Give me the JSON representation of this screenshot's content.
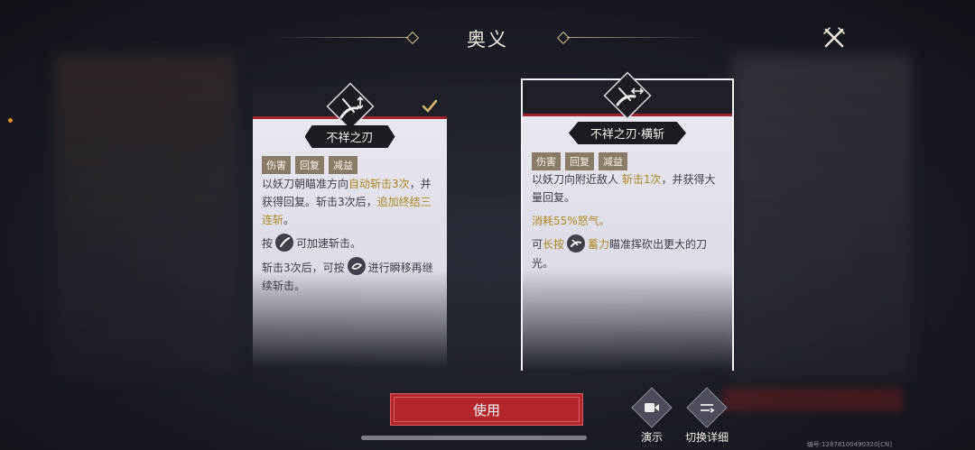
{
  "header": {
    "title": "奥义"
  },
  "cards": [
    {
      "name": "不祥之刃",
      "tags": [
        "伤害",
        "回复",
        "减益"
      ],
      "desc": {
        "p1_a": "以妖刀朝瞄准方向",
        "p1_hl1": "自动斩击3次",
        "p1_b": "，并获得回复。斩击3次后，",
        "p1_hl2": "追加终结三连斩",
        "p1_c": "。",
        "p2_a": "按",
        "p2_b": "可加速斩击。",
        "p3_a": "斩击3次后，可按",
        "p3_b": "进行瞬移再继续斩击。"
      },
      "selected": true
    },
    {
      "name": "不祥之刃·横斩",
      "tags": [
        "伤害",
        "回复",
        "减益"
      ],
      "desc": {
        "p1_a": "以妖刀向附近敌人 ",
        "p1_hl1": "斩击1次",
        "p1_b": "，并获得大量回复。",
        "p2_hl": "消耗55%怒气",
        "p2_b": "。",
        "p3_a": "可",
        "p3_hl1": "长按",
        "p3_hl2": "蓄力",
        "p3_b": "瞄准挥砍出更大的刀光。"
      },
      "selected": false
    }
  ],
  "buttons": {
    "use": "使用",
    "demo": "演示",
    "switch": "切换详细"
  },
  "footer": {
    "serial": "编号:12878100490320[CN]"
  },
  "colors": {
    "accent_red": "#b4262c",
    "highlight_gold": "#b0861f",
    "tag_bg": "#8a7b66"
  },
  "icons": [
    "close-icon",
    "blade-vertical-icon",
    "blade-horizontal-icon",
    "checkmark-icon",
    "slash-icon",
    "dash-icon",
    "charge-icon",
    "video-icon",
    "switch-detail-icon"
  ]
}
